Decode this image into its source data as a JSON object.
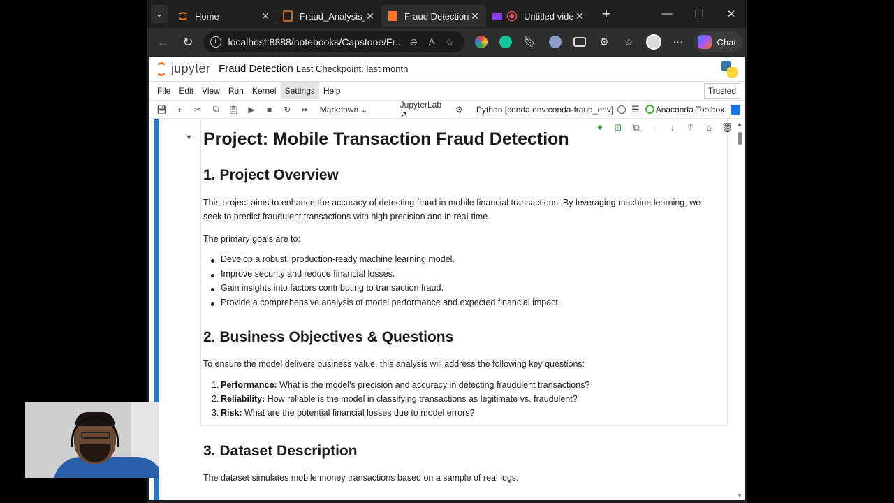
{
  "browser": {
    "tabs": [
      {
        "title": "Home",
        "icon": "jupyter-icon"
      },
      {
        "title": "Fraud_Analysis_D",
        "icon": "notebook-file-icon"
      },
      {
        "title": "Fraud Detection",
        "icon": "notebook-file-icon",
        "active": true
      },
      {
        "title": "Untitled vide",
        "icon": "record-icon"
      }
    ],
    "url": "localhost:8888/notebooks/Capstone/Fr...",
    "chat_label": "Chat"
  },
  "jupyter": {
    "logo_text": "jupyter",
    "notebook_name": "Fraud Detection",
    "checkpoint": "Last Checkpoint: last month",
    "menu": [
      "File",
      "Edit",
      "View",
      "Run",
      "Kernel",
      "Settings",
      "Help"
    ],
    "trusted": "Trusted",
    "cell_type": "Markdown",
    "jupyterlab_link": "JupyterLab",
    "kernel": "Python [conda env:conda-fraud_env]",
    "anaconda": "Anaconda Toolbox"
  },
  "notebook": {
    "h1": "Project: Mobile Transaction Fraud Detection",
    "s1_title": "1. Project Overview",
    "s1_p1_line1": "This project aims to enhance the accuracy of detecting fraud in mobile financial transactions. By leveraging machine learning, we",
    "s1_p1_line2": "seek to predict fraudulent transactions with high precision and in real-time.",
    "s1_p2": "The primary goals are to:",
    "goals": [
      "Develop a robust, production-ready machine learning model.",
      "Improve security and reduce financial losses.",
      "Gain insights into factors contributing to transaction fraud.",
      "Provide a comprehensive analysis of model performance and expected financial impact."
    ],
    "s2_title": "2. Business Objectives & Questions",
    "s2_p1": "To ensure the model delivers business value, this analysis will address the following key questions:",
    "questions": [
      {
        "num": "1.",
        "label": "Performance:",
        "text": " What is the model's precision and accuracy in detecting fraudulent transactions?"
      },
      {
        "num": "2.",
        "label": "Reliability:",
        "text": " How reliable is the model in classifying transactions as legitimate vs. fraudulent?"
      },
      {
        "num": "3.",
        "label": "Risk:",
        "text": " What are the potential financial losses due to model errors?"
      }
    ],
    "s3_title": "3. Dataset Description",
    "s3_p1": "The dataset simulates mobile money transactions based on a sample of real logs."
  }
}
